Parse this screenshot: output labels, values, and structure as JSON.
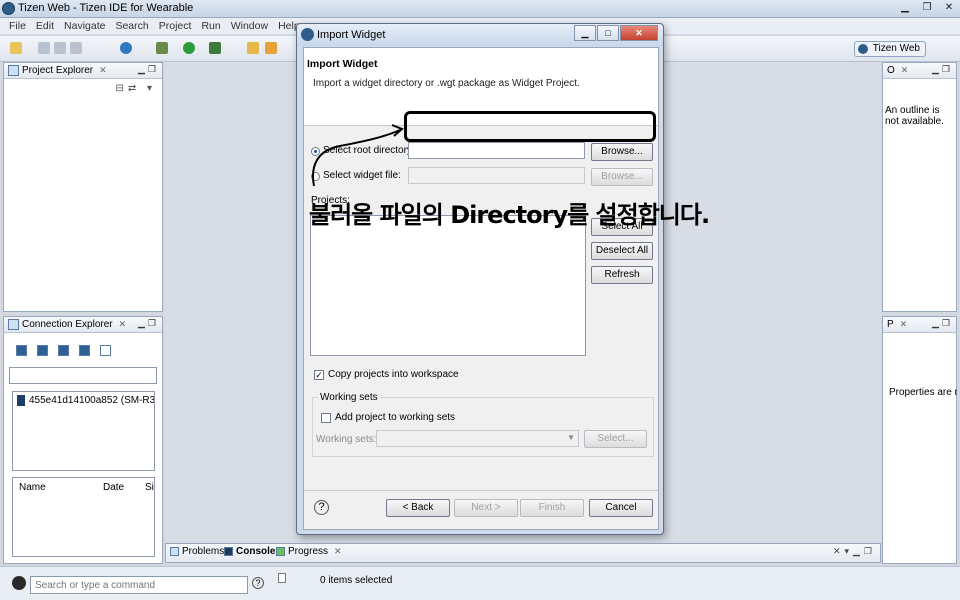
{
  "window": {
    "title": "Tizen Web - Tizen IDE for Wearable"
  },
  "menu": [
    "File",
    "Edit",
    "Navigate",
    "Search",
    "Project",
    "Run",
    "Window",
    "Help"
  ],
  "toolbar": {
    "perspective_label": "Tizen Web"
  },
  "project_explorer": {
    "title": "Project Explorer"
  },
  "connection_explorer": {
    "title": "Connection Explorer",
    "device": "455e41d14100a852 (SM-R3",
    "columns": [
      "Name",
      "Date",
      "Si"
    ]
  },
  "outline": {
    "title": "O",
    "message": "An outline is not available."
  },
  "properties": {
    "title": "P",
    "message": "Properties are not"
  },
  "console_tabs": [
    "Problems",
    "Console",
    "Progress"
  ],
  "status": {
    "command_placeholder": "Search or type a command",
    "selection": "0 items selected"
  },
  "dialog": {
    "title": "Import Widget",
    "heading": "Import Widget",
    "description": "Import a widget directory or .wgt package as Widget Project.",
    "root_dir_label": "Select root directory:",
    "root_dir_value": "",
    "widget_file_label": "Select widget file:",
    "browse_label": "Browse...",
    "projects_label": "Projects:",
    "select_all_label": "Select All",
    "deselect_all_label": "Deselect All",
    "refresh_label": "Refresh",
    "copy_label": "Copy projects into workspace",
    "working_sets_group": "Working sets",
    "add_working_sets_label": "Add project to working sets",
    "working_sets_label": "Working sets:",
    "select_label": "Select...",
    "back_label": "< Back",
    "next_label": "Next >",
    "finish_label": "Finish",
    "cancel_label": "Cancel",
    "help_label": "?"
  },
  "annotation": {
    "text": "불러올 파일의 Directory를 설정합니다."
  }
}
